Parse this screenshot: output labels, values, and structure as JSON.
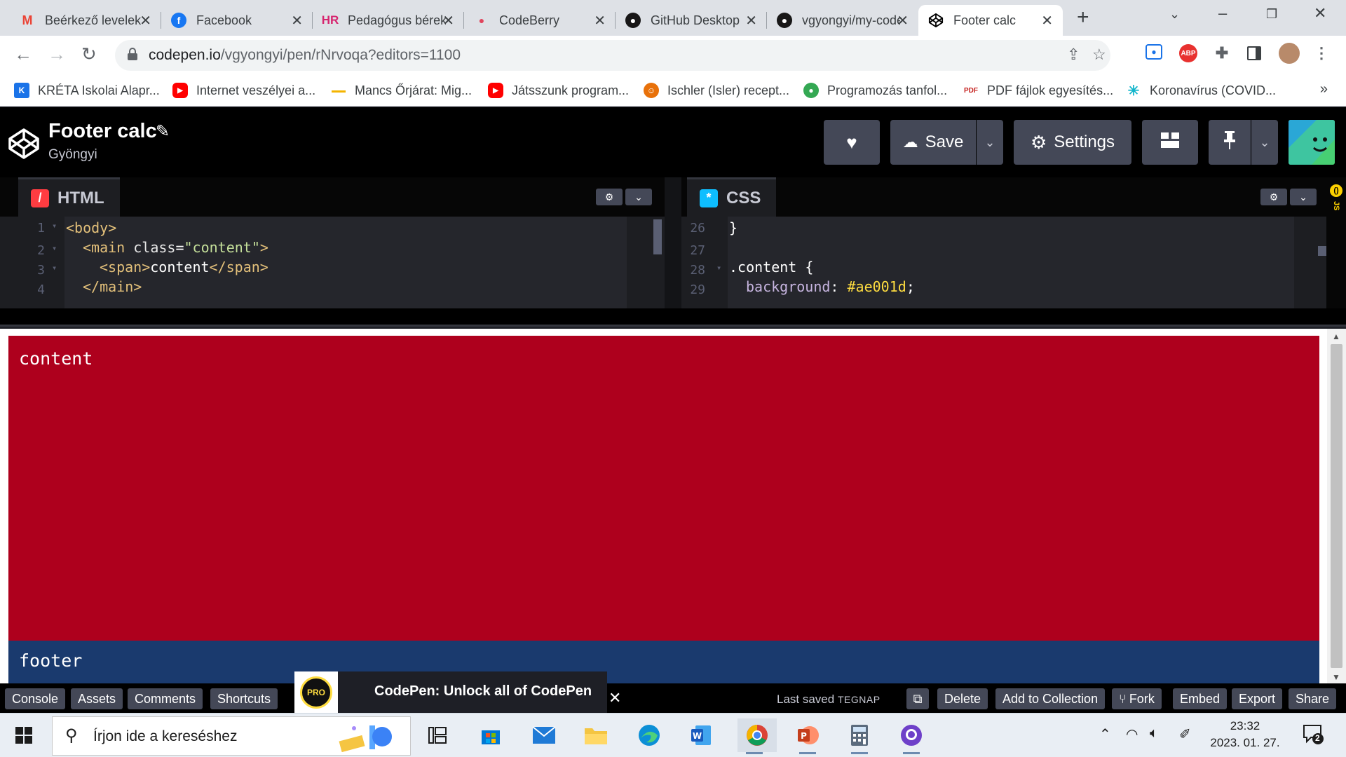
{
  "browser": {
    "tabs": [
      {
        "title": "Beérkező levelek",
        "favicon": "gmail-icon",
        "color": "#ea4335",
        "active": false
      },
      {
        "title": "Facebook",
        "favicon": "facebook-icon",
        "color": "#1877f2",
        "active": false
      },
      {
        "title": "Pedagógus bérek",
        "favicon": "hr-icon",
        "color": "#d6246e",
        "active": false
      },
      {
        "title": "CodeBerry",
        "favicon": "codeberry-icon",
        "color": "#e0445c",
        "active": false
      },
      {
        "title": "GitHub Desktop",
        "favicon": "github-icon",
        "color": "#181717",
        "active": false
      },
      {
        "title": "vgyongyi/my-code",
        "favicon": "github-icon",
        "color": "#181717",
        "active": false
      },
      {
        "title": "Footer calc",
        "favicon": "codepen-icon",
        "color": "#000000",
        "active": true
      }
    ],
    "address": {
      "host": "codepen.io",
      "path": "/vgyongyi/pen/rNrvoqa?editors=1100"
    },
    "bookmarks": [
      {
        "label": "KRÉTA Iskolai Alapr...",
        "icon": "kreta-icon",
        "color": "#1a73e8"
      },
      {
        "label": "Internet veszélyei a...",
        "icon": "youtube-icon",
        "color": "#ff0000"
      },
      {
        "label": "Mancs Őrjárat: Mig...",
        "icon": "mancs-icon",
        "color": "#f4b400"
      },
      {
        "label": "Játsszunk program...",
        "icon": "youtube-icon",
        "color": "#ff0000"
      },
      {
        "label": "Ischler (Isler) recept...",
        "icon": "recipe-icon",
        "color": "#e8710a"
      },
      {
        "label": "Programozás tanfol...",
        "icon": "course-icon",
        "color": "#34a853"
      },
      {
        "label": "PDF fájlok egyesítés...",
        "icon": "pdf-icon",
        "color": "#c5221f"
      },
      {
        "label": "Koronavírus (COVID...",
        "icon": "covid-icon",
        "color": "#12b5cb"
      }
    ]
  },
  "codepen": {
    "pen_title": "Footer calc",
    "author": "Gyöngyi",
    "buttons": {
      "save": "Save",
      "settings": "Settings"
    },
    "editors": {
      "html": {
        "name": "HTML",
        "color": "#ff3c41",
        "lines": [
          {
            "num": "1"
          },
          {
            "num": "2"
          },
          {
            "num": "3"
          },
          {
            "num": "4"
          }
        ],
        "tokens": {
          "l1": "<body>",
          "l2_open": "<main ",
          "l2_attr": "class",
          "l2_eq": "=",
          "l2_str": "\"content\"",
          "l2_close": ">",
          "l3_open": "<span>",
          "l3_text": "content",
          "l3_close": "</span>",
          "l4": "</main>"
        }
      },
      "css": {
        "name": "CSS",
        "color": "#0ebeff",
        "lines": [
          {
            "num": "26"
          },
          {
            "num": "27"
          },
          {
            "num": "28"
          },
          {
            "num": "29"
          }
        ],
        "tokens": {
          "l26": "}",
          "l28_sel": ".content",
          "l28_brace": " {",
          "l29_prop": "background",
          "l29_colon": ": ",
          "l29_val": "#ae001d",
          "l29_semi": ";"
        }
      },
      "js_collapsed_label": "JS"
    },
    "preview": {
      "content_text": "content",
      "footer_text": "footer",
      "content_color": "#ae001d",
      "footer_color": "#1a3a6e"
    },
    "footer_bar": {
      "console": "Console",
      "assets": "Assets",
      "comments": "Comments",
      "shortcuts": "Shortcuts",
      "promo_badge": "PRO",
      "promo": "CodePen: Unlock all of CodePen",
      "last_saved_label": "Last saved",
      "last_saved_when": "TEGNAP",
      "delete": "Delete",
      "add_to_collection": "Add to Collection",
      "fork": "Fork",
      "embed": "Embed",
      "export": "Export",
      "share": "Share"
    }
  },
  "taskbar": {
    "search_placeholder": "Írjon ide a kereséshez",
    "apps": [
      "task-view-icon",
      "ms-store-icon",
      "mail-icon",
      "file-explorer-icon",
      "edge-icon",
      "word-icon",
      "chrome-icon",
      "powerpoint-icon",
      "calculator-icon",
      "github-desktop-icon"
    ],
    "clock_time": "23:32",
    "clock_date": "2023. 01. 27.",
    "notifications": "2"
  }
}
